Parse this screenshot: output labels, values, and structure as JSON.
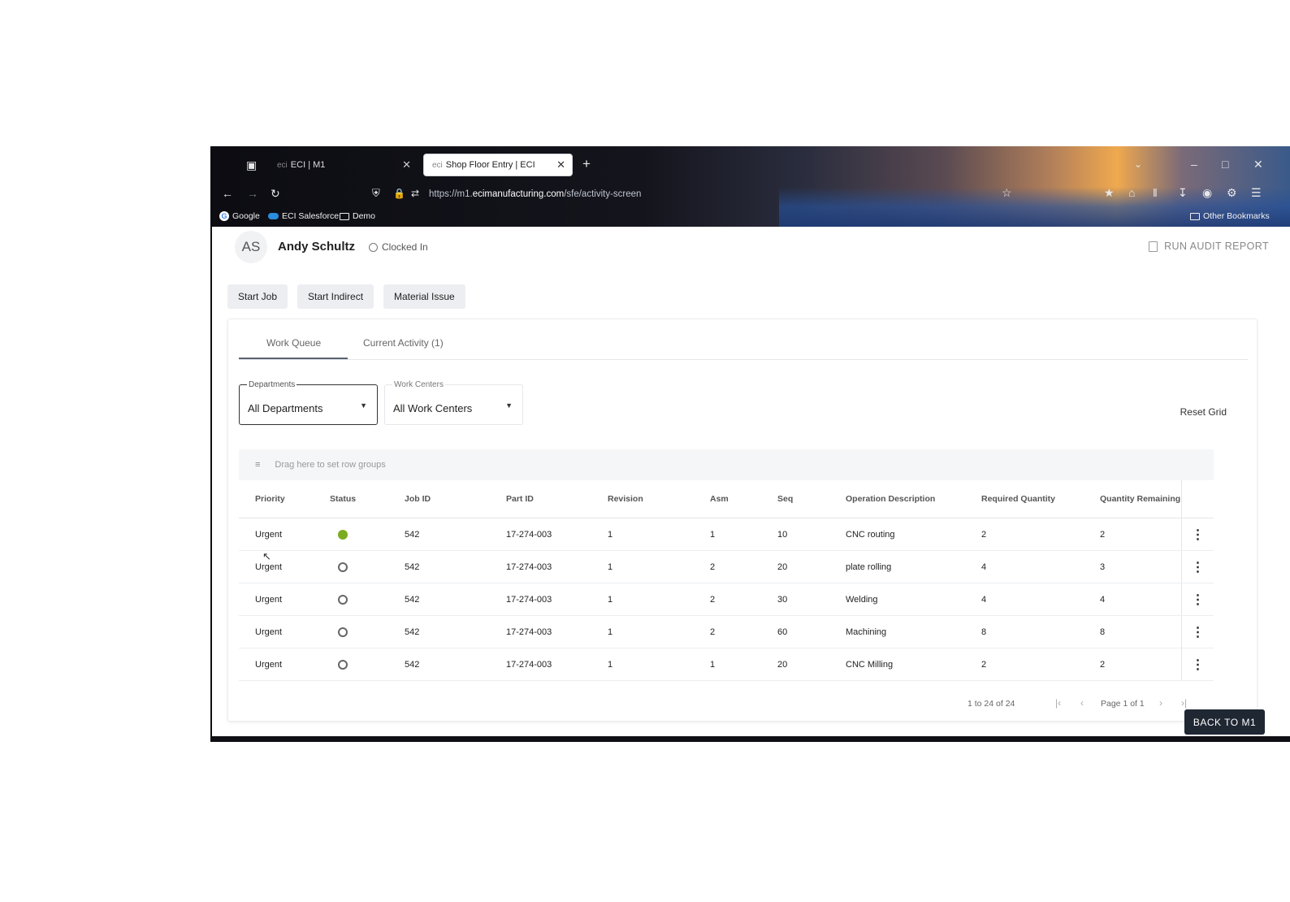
{
  "browser": {
    "tabs": [
      {
        "favicon": "eci",
        "title": "ECI | M1",
        "active": false
      },
      {
        "favicon": "eci",
        "title": "Shop Floor Entry | ECI",
        "active": true
      }
    ],
    "url": {
      "prefix": "https://m1.",
      "domain": "ecimanufacturing.com",
      "path": "/sfe/activity-screen"
    },
    "bookmarks": [
      {
        "label": "Google",
        "icon": "google-icon"
      },
      {
        "label": "ECI Salesforce",
        "icon": "cloud-icon"
      },
      {
        "label": "Demo",
        "icon": "folder-icon"
      }
    ],
    "other_bookmarks": "Other Bookmarks"
  },
  "header": {
    "avatar_initials": "AS",
    "user_name": "Andy Schultz",
    "clock_status": "Clocked In",
    "audit_label": "RUN AUDIT REPORT"
  },
  "actions": {
    "start_job": "Start Job",
    "start_indirect": "Start Indirect",
    "material_issue": "Material Issue"
  },
  "tabs": {
    "work_queue": "Work Queue",
    "current_activity": "Current Activity (1)",
    "selected": "Work Queue"
  },
  "filters": {
    "departments_label": "Departments",
    "departments_value": "All Departments",
    "work_centers_label": "Work Centers",
    "work_centers_value": "All Work Centers",
    "reset": "Reset Grid"
  },
  "grid": {
    "group_placeholder": "Drag here to set row groups",
    "columns": [
      "Priority",
      "Status",
      "Job ID",
      "Part ID",
      "Revision",
      "Asm",
      "Seq",
      "Operation Description",
      "Required Quantity",
      "Quantity Remaining"
    ],
    "rows": [
      {
        "priority": "Urgent",
        "status": "active",
        "job": "542",
        "part": "17-274-003",
        "rev": "1",
        "asm": "1",
        "seq": "10",
        "op": "CNC routing",
        "req": "2",
        "rem": "2"
      },
      {
        "priority": "Urgent",
        "status": "idle",
        "job": "542",
        "part": "17-274-003",
        "rev": "1",
        "asm": "2",
        "seq": "20",
        "op": "plate rolling",
        "req": "4",
        "rem": "3"
      },
      {
        "priority": "Urgent",
        "status": "idle",
        "job": "542",
        "part": "17-274-003",
        "rev": "1",
        "asm": "2",
        "seq": "30",
        "op": "Welding",
        "req": "4",
        "rem": "4"
      },
      {
        "priority": "Urgent",
        "status": "idle",
        "job": "542",
        "part": "17-274-003",
        "rev": "1",
        "asm": "2",
        "seq": "60",
        "op": "Machining",
        "req": "8",
        "rem": "8"
      },
      {
        "priority": "Urgent",
        "status": "idle",
        "job": "542",
        "part": "17-274-003",
        "rev": "1",
        "asm": "1",
        "seq": "20",
        "op": "CNC Milling",
        "req": "2",
        "rem": "2"
      }
    ],
    "pager": {
      "range": "1 to 24 of 24",
      "page": "Page 1 of 1"
    }
  },
  "back_button": "BACK TO M1",
  "colors": {
    "active_status": "#7bab1e",
    "back_button_bg": "#1f2733"
  }
}
